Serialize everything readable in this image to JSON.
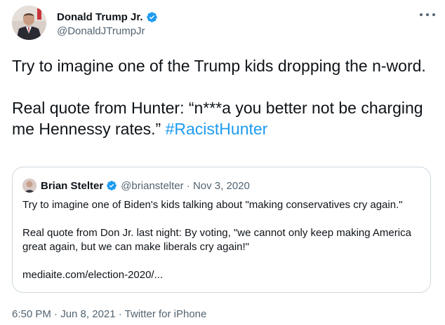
{
  "author": {
    "name": "Donald Trump Jr.",
    "handle": "@DonaldJTrumpJr"
  },
  "tweet": {
    "line1": "Try to imagine one of the Trump kids dropping the n-word.",
    "line2": "Real quote from Hunter: “n***a you better not be charging me Hennessy rates.”",
    "hashtag": "#RacistHunter"
  },
  "quoted": {
    "name": "Brian Stelter",
    "handle_date": "@brianstelter · Nov 3, 2020",
    "text1": "Try to imagine one of Biden's kids talking about \"making conservatives cry again.\"",
    "text2": "Real quote from Don Jr. last night: By voting, \"we cannot only keep making America great again, but we can make liberals cry again!\"",
    "link": "mediaite.com/election-2020/..."
  },
  "meta": {
    "timestamp": "6:50 PM · Jun 8, 2021 · Twitter for iPhone"
  },
  "icons": {
    "verified": "verified-badge-icon",
    "more": "more-options-icon"
  },
  "colors": {
    "accent": "#1d9bf0",
    "secondary_text": "#536471",
    "border": "#cfd9de"
  }
}
